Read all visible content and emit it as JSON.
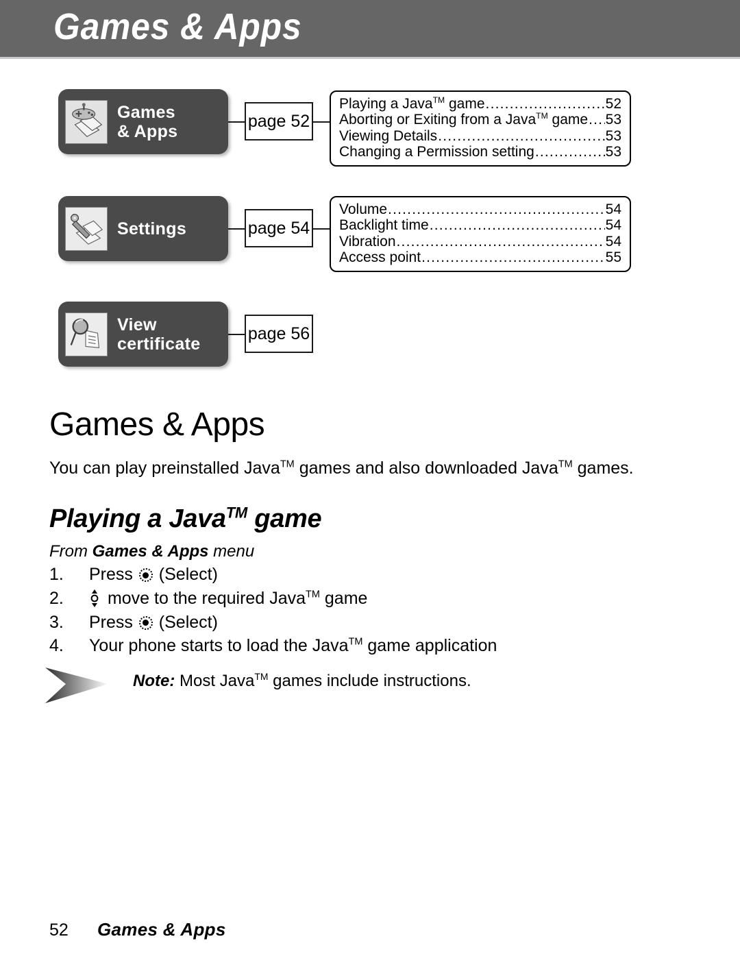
{
  "header": {
    "title": "Games & Apps",
    "bar_color": "#666666",
    "title_color": "#ffffff"
  },
  "map": {
    "box_color": "#4a4a4a",
    "rows": [
      {
        "menu_label": "Games\n& Apps",
        "icon": "gamepad-cards-icon",
        "page_label": "page 52",
        "toc": [
          {
            "label_pre": "Playing a Java",
            "label_tm": "TM",
            "label_post": " game",
            "page": "52"
          },
          {
            "label_pre": "Aborting or Exiting from a Java",
            "label_tm": "TM",
            "label_post": " game ",
            "page": "53"
          },
          {
            "label_pre": "Viewing Details",
            "label_tm": "",
            "label_post": "",
            "page": "53"
          },
          {
            "label_pre": "Changing a Permission setting",
            "label_tm": "",
            "label_post": "",
            "page": "53"
          }
        ]
      },
      {
        "menu_label": "Settings",
        "icon": "wrench-settings-icon",
        "page_label": "page 54",
        "toc": [
          {
            "label_pre": "Volume",
            "label_tm": "",
            "label_post": "",
            "page": "54"
          },
          {
            "label_pre": "Backlight time ",
            "label_tm": "",
            "label_post": "",
            "page": "54"
          },
          {
            "label_pre": "Vibration ",
            "label_tm": "",
            "label_post": "",
            "page": "54"
          },
          {
            "label_pre": "Access point ",
            "label_tm": "",
            "label_post": "",
            "page": "55"
          }
        ]
      },
      {
        "menu_label": "View\ncertificate",
        "icon": "magnifier-document-icon",
        "page_label": "page 56",
        "toc": []
      }
    ]
  },
  "content": {
    "section_title": "Games & Apps",
    "intro_pre": "You can play preinstalled Java",
    "intro_tm": "TM",
    "intro_mid": " games and also downloaded Java",
    "intro_tm2": "TM",
    "intro_post": " games.",
    "subhead_pre": "Playing a Java",
    "subhead_tm": "TM",
    "subhead_post": " game",
    "from_pre": "From ",
    "from_bold": "Games & Apps",
    "from_post": " menu",
    "steps": [
      {
        "num": "1.",
        "pre": "Press ",
        "key": "select-key-icon",
        "post": " (Select)",
        "tm": ""
      },
      {
        "num": "2.",
        "pre": "",
        "key": "updown-key-icon",
        "post": " move to the required Java",
        "tm": "TM",
        "tail": " game"
      },
      {
        "num": "3.",
        "pre": "Press ",
        "key": "select-key-icon",
        "post": " (Select)",
        "tm": ""
      },
      {
        "num": "4.",
        "pre": "Your phone starts to load the Java",
        "key": "",
        "post": "",
        "tm": "TM",
        "tail": " game application"
      }
    ],
    "note_label": "Note:",
    "note_pre": " Most Java",
    "note_tm": "TM",
    "note_post": " games include instructions."
  },
  "footer": {
    "page_number": "52",
    "title": "Games & Apps"
  }
}
